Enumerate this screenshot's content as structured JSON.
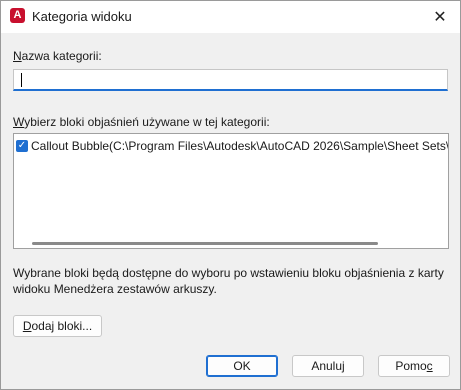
{
  "window": {
    "title": "Kategoria widoku",
    "close_glyph": "✕",
    "app_icon_letter": "A"
  },
  "category_name": {
    "label": "Nazwa kategorii:",
    "label_hotkey": "N",
    "label_rest": "azwa kategorii:",
    "value": ""
  },
  "blocks": {
    "label_hotkey": "W",
    "label_rest": "ybierz bloki objaśnień używane w tej kategorii:",
    "items": [
      {
        "checked": true,
        "text": "Callout Bubble(C:\\Program Files\\Autodesk\\AutoCAD 2026\\Sample\\Sheet Sets\\Architectural"
      }
    ]
  },
  "info_text": "Wybrane bloki będą dostępne do wyboru po wstawieniu bloku objaśnienia z karty widoku Menedżera zestawów arkuszy.",
  "buttons": {
    "add_hotkey": "D",
    "add_rest": "odaj bloki...",
    "ok": "OK",
    "cancel": "Anuluj",
    "help_pre": "Pomo",
    "help_hotkey": "c"
  }
}
